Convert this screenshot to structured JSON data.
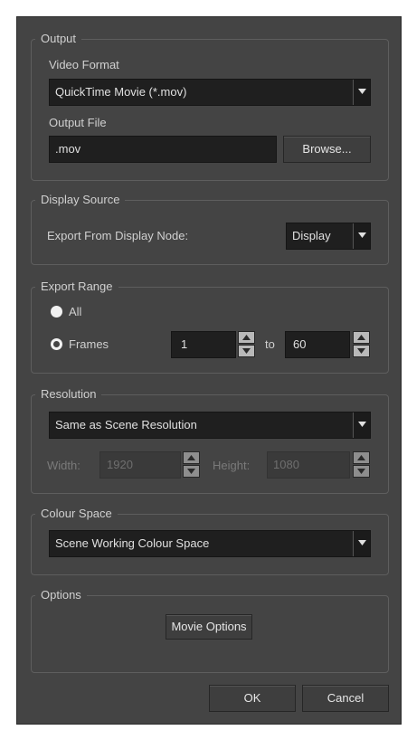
{
  "output": {
    "legend": "Output",
    "video_format_label": "Video Format",
    "video_format_value": "QuickTime Movie (*.mov)",
    "output_file_label": "Output File",
    "output_file_value": ".mov",
    "browse_label": "Browse..."
  },
  "display_source": {
    "legend": "Display Source",
    "export_from_label": "Export From Display Node:",
    "display_value": "Display"
  },
  "export_range": {
    "legend": "Export Range",
    "all_label": "All",
    "frames_label": "Frames",
    "from_value": "1",
    "to_label": "to",
    "to_value": "60",
    "selected": "All"
  },
  "resolution": {
    "legend": "Resolution",
    "preset_value": "Same as Scene Resolution",
    "width_label": "Width:",
    "width_value": "1920",
    "height_label": "Height:",
    "height_value": "1080"
  },
  "colour_space": {
    "legend": "Colour Space",
    "value": "Scene Working Colour Space"
  },
  "options": {
    "legend": "Options",
    "movie_options_label": "Movie Options"
  },
  "footer": {
    "ok_label": "OK",
    "cancel_label": "Cancel"
  }
}
